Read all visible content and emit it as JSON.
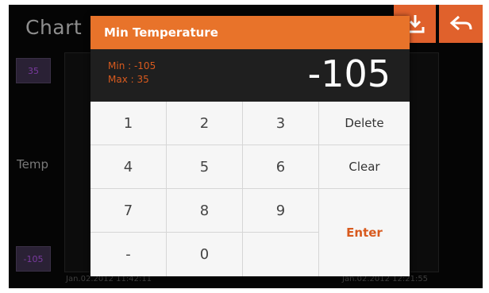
{
  "app": {
    "title": "Chart"
  },
  "chart": {
    "y_axis_label": "Temp",
    "y_max_button": "35",
    "y_min_button": "-105",
    "x_start_time": "Jan.02.2012  11:42:11",
    "x_end_time": "Jan.02.2012  12:21:55"
  },
  "toolbar": {
    "download_icon": "download-icon",
    "back_icon": "back-arrow-icon",
    "accent_color": "#e0612c"
  },
  "dialog": {
    "title": "Min Temperature",
    "min_label": "Min : -105",
    "max_label": "Max : 35",
    "value": "-105",
    "header_color": "#e8732a",
    "accent_text_color": "#d85a1e"
  },
  "keypad": {
    "k1": "1",
    "k2": "2",
    "k3": "3",
    "k4": "4",
    "k5": "5",
    "k6": "6",
    "k7": "7",
    "k8": "8",
    "k9": "9",
    "minus": "-",
    "k0": "0",
    "delete": "Delete",
    "clear": "Clear",
    "enter": "Enter"
  }
}
